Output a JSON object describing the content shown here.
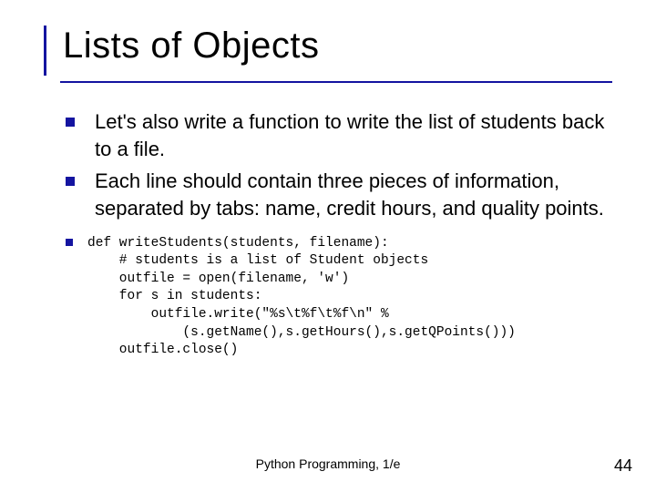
{
  "title": "Lists of Objects",
  "bullets": [
    "Let's also write a function to write the list of students back to a file.",
    "Each line should contain three pieces of information, separated by tabs: name, credit hours, and quality points."
  ],
  "code": "def writeStudents(students, filename):\n    # students is a list of Student objects\n    outfile = open(filename, 'w')\n    for s in students:\n        outfile.write(\"%s\\t%f\\t%f\\n\" %\n            (s.getName(),s.getHours(),s.getQPoints()))\n    outfile.close()",
  "footer": {
    "center": "Python Programming, 1/e",
    "page": "44"
  }
}
